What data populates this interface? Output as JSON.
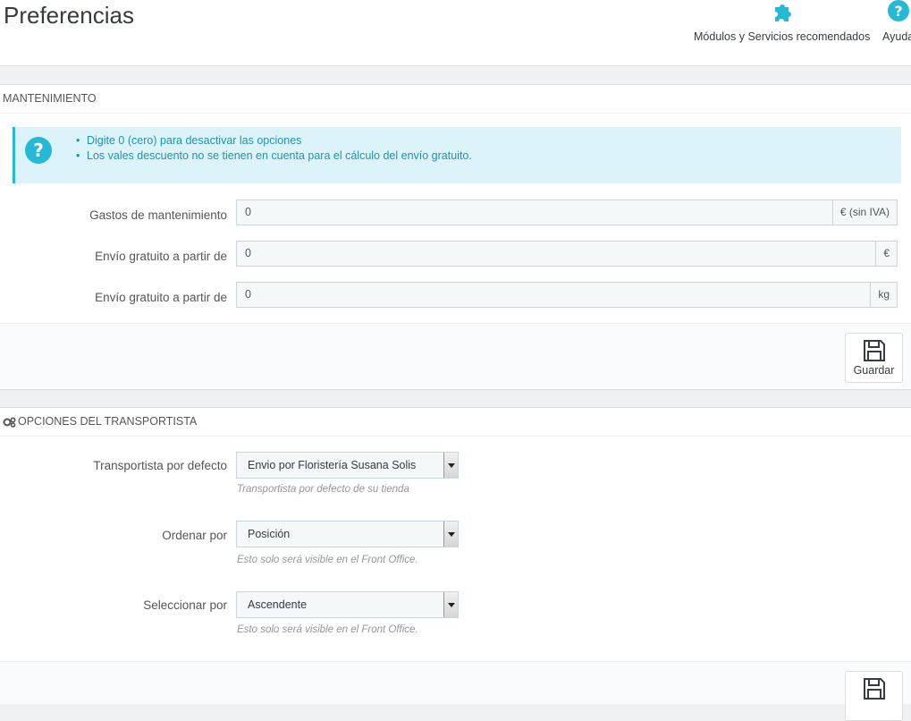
{
  "header": {
    "title": "Preferencias",
    "toolbar": [
      {
        "label": "Módulos y Servicios recomendados",
        "icon": "puzzle-icon"
      },
      {
        "label": "Ayuda",
        "icon": "help-icon"
      }
    ]
  },
  "colors": {
    "accent": "#25b9d7",
    "alert_bg": "#dcf4f9",
    "alert_text": "#1e94ab"
  },
  "maintenance": {
    "heading": "MANTENIMIENTO",
    "alert_items": [
      "Digite 0 (cero) para desactivar las opciones",
      "Los vales descuento no se tienen en cuenta para el cálculo del envío gratuito."
    ],
    "fields": [
      {
        "label": "Gastos de mantenimiento",
        "value": "0",
        "addon": "€ (sin IVA)"
      },
      {
        "label": "Envío gratuito a partir de",
        "value": "0",
        "addon": "€"
      },
      {
        "label": "Envío gratuito a partir de",
        "value": "0",
        "addon": "kg"
      }
    ],
    "save_label": "Guardar"
  },
  "carrier": {
    "heading": "OPCIONES DEL TRANSPORTISTA",
    "fields": [
      {
        "label": "Transportista por defecto",
        "value": "Envio por Floristería Susana Solis",
        "help": "Transportista por defecto de su tienda"
      },
      {
        "label": "Ordenar por",
        "value": "Posición",
        "help": "Esto solo será visible en el Front Office."
      },
      {
        "label": "Seleccionar por",
        "value": "Ascendente",
        "help": "Esto solo será visible en el Front Office."
      }
    ]
  }
}
